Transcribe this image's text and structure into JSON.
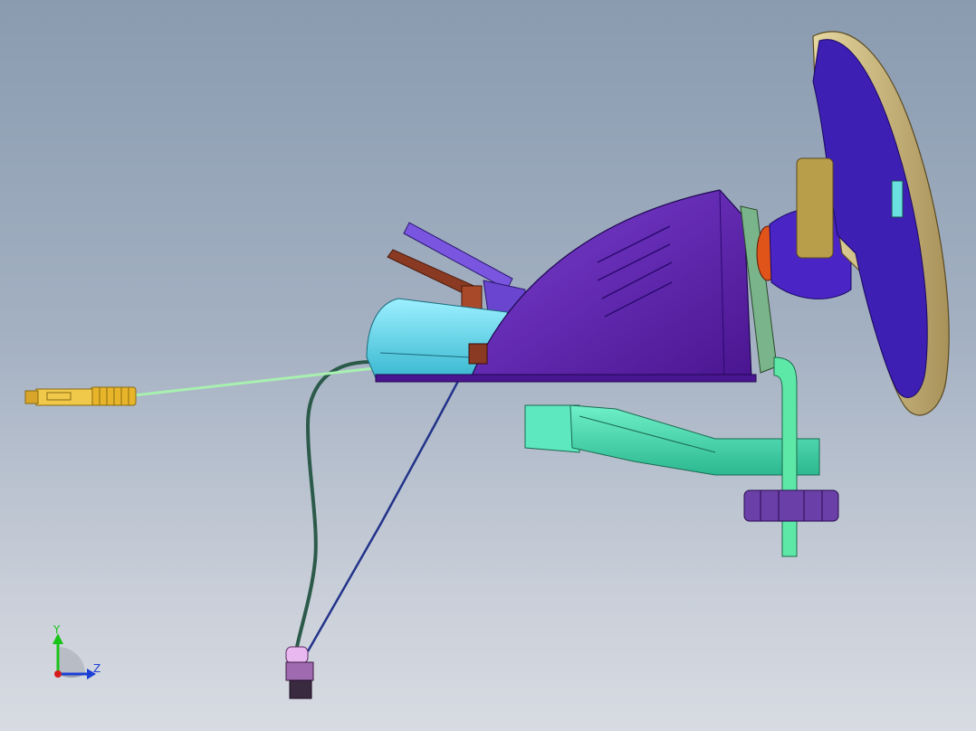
{
  "viewport": {
    "background_top": "#8a9bb0",
    "background_bottom": "#d8dbe2"
  },
  "triad": {
    "y_label": "Y",
    "z_label": "Z",
    "y_color": "#19c419",
    "z_color": "#1c3fd6",
    "x_color": "#d61c1c"
  },
  "colors": {
    "wheel_rim": "#c9b57a",
    "wheel_body": "#3d1fb4",
    "housing": "#5a1fa8",
    "base": "#4fd6ea",
    "clamp": "#3fe0b0",
    "knob": "#6a3fa8",
    "cable_green": "#a8f0b0",
    "cable_dark": "#2c5a4a",
    "cable_blue": "#22338a",
    "usb": "#e8b52a",
    "lever_violet": "#7a55e0",
    "lever_brown": "#8a3a22"
  }
}
